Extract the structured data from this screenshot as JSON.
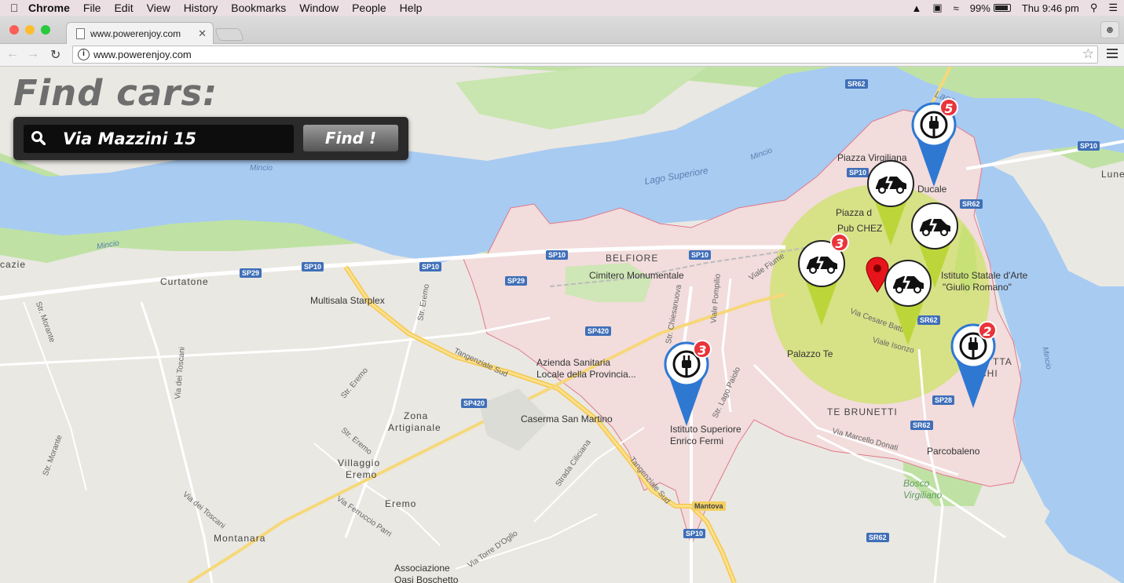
{
  "menubar": {
    "app": "Chrome",
    "items": [
      "File",
      "Edit",
      "View",
      "History",
      "Bookmarks",
      "Window",
      "People",
      "Help"
    ],
    "battery": "99%",
    "clock": "Thu 9:46 pm"
  },
  "browser": {
    "tab_title": "www.powerenjoy.com",
    "url": "www.powerenjoy.com"
  },
  "page": {
    "title": "Find  cars:",
    "search_value": "Via Mazzini 15",
    "find_button": "Find !"
  },
  "markers": {
    "station_north_count": "5",
    "station_south_count": "3",
    "station_east_count": "2",
    "car_cluster_count": "3"
  },
  "map_labels": {
    "lago_superiore": "Lago Superiore",
    "lago": "Lago",
    "mincio1": "Mincio",
    "mincio2": "Mincio",
    "mincio3": "Mincio",
    "mincio4": "Mincio",
    "piazza_virgiliana": "Piazza Virgiliana",
    "ducale": "Ducale",
    "piazza_d": "Piazza d",
    "pub_chez": "Pub CHEZ",
    "belfiore": "BELFIORE",
    "cimitero": "Cimitero Monumentale",
    "curtatone": "Curtatone",
    "multisala": "Multisala Starplex",
    "azienda1": "Azienda Sanitaria",
    "azienda2": "Locale della Provincia...",
    "caserma": "Caserma San Martino",
    "zona1": "Zona",
    "zona2": "Artigianale",
    "villaggio1": "Villaggio",
    "villaggio2": "Eremo",
    "eremo": "Eremo",
    "montanara": "Montanara",
    "istituto_fermi1": "Istituto Superiore",
    "istituto_fermi2": "Enrico Fermi",
    "palazzo_te": "Palazzo Te",
    "te_brunetti": "TE BRUNETTI",
    "istituto_arte1": "Istituto Statale d'Arte",
    "istituto_arte2": "\"Giulio Romano\"",
    "parcobaleno": "Parcobaleno",
    "bosco1": "Bosco",
    "bosco2": "Virgiliano",
    "associazione1": "Associazione",
    "associazione2": "Oasi Boschetto",
    "tangenziale1": "Tangenziale Sud",
    "tangenziale2": "Tangenziale Sud",
    "mantova": "Mantova",
    "cazie": "cazie",
    "lune": "Lune",
    "tta": "TTA",
    "vacchi": "V   CCHI"
  },
  "roads": {
    "sp10a": "SP10",
    "sp10b": "SP10",
    "sp10c": "SP10",
    "sp10d": "SP10",
    "sp10e": "SP10",
    "sp10f": "SP10",
    "sr62a": "SR62",
    "sr62b": "SR62",
    "sr62c": "SR62",
    "sr62d": "SR62",
    "sr62e": "SR62",
    "sp29a": "SP29",
    "sp29b": "SP29",
    "sp420a": "SP420",
    "sp420b": "SP420",
    "sp28": "SP28",
    "str_eremo1": "Str. Eremo",
    "str_eremo2": "Str. Eremo",
    "str_eremo3": "Str. Eremo",
    "via_toscani1": "Via dei Toscani",
    "via_toscani2": "Via dei Toscani",
    "str_morante1": "Str. Morante",
    "str_morante2": "Str. Morante",
    "ferruccio": "Via Ferruccio Parri",
    "strada_ciliciana": "Strada Ciliciana",
    "torre": "Via Torre D'Oglio",
    "chiesanuova": "Str. Chiesanuova",
    "pompilio": "Viale Pompilio",
    "lago_paiolo": "Str. Lago Paiolo",
    "marcello_donati": "Via Marcello Donati",
    "viale_fiume": "Viale Fiume",
    "viale_isonzo": "Viale Isonzo",
    "cesare_battisti": "Via Cesare Battisti"
  }
}
